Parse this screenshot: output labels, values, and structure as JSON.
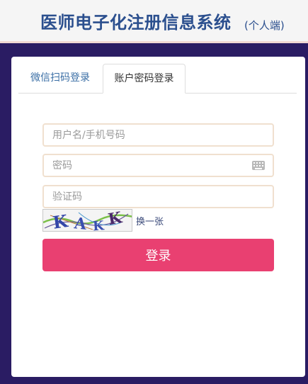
{
  "header": {
    "title": "医师电子化注册信息系统",
    "subtitle": "(个人端)"
  },
  "tabs": [
    {
      "label": "微信扫码登录",
      "active": false
    },
    {
      "label": "账户密码登录",
      "active": true
    }
  ],
  "form": {
    "username_placeholder": "用户名/手机号码",
    "password_placeholder": "密码",
    "captcha_placeholder": "验证码",
    "refresh_label": "换一张",
    "login_label": "登录",
    "captcha_text": "KAKK"
  },
  "icons": {
    "keyboard": "keyboard-icon"
  },
  "colors": {
    "page_background": "#2a1c63",
    "header_background": "#f5f5f5",
    "title_color": "#2b4f8e",
    "login_button": "#e94071",
    "input_border": "#f0e0cf"
  }
}
